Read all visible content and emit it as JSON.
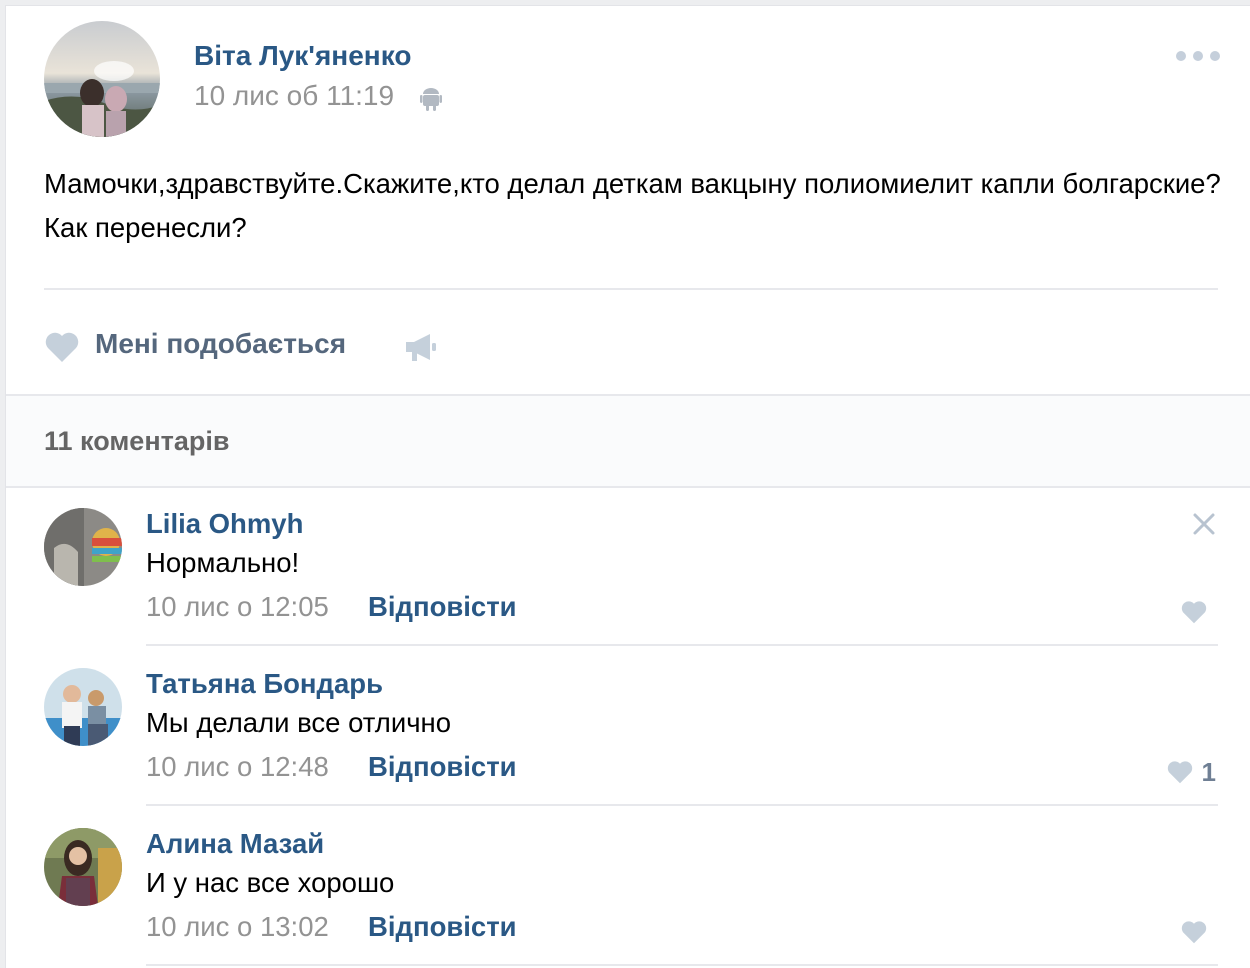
{
  "post": {
    "author": "Віта Лук'яненко",
    "date": "10 лис об 11:19",
    "device_icon": "android-icon",
    "text": "Мамочки,здравствуйте.Скажите,кто делал деткам вакцыну полиомиелит капли болгарские? Как перенесли?",
    "more_icon": "more-dots-icon"
  },
  "actions": {
    "like_label": "Мені подобається",
    "like_icon": "heart-icon",
    "share_icon": "megaphone-icon"
  },
  "comments_header": {
    "count_label": "11 коментарів"
  },
  "comments": [
    {
      "author": "Lilia Ohmyh",
      "text": "Нормально!",
      "date": "10 лис о 12:05",
      "reply": "Відповісти",
      "likes": "",
      "show_close": true
    },
    {
      "author": "Татьяна Бондарь",
      "text": "Мы делали все отлично",
      "date": "10 лис о 12:48",
      "reply": "Відповісти",
      "likes": "1",
      "show_close": false
    },
    {
      "author": "Алина Мазай",
      "text": "И у нас все хорошо",
      "date": "10 лис о 13:02",
      "reply": "Відповісти",
      "likes": "",
      "show_close": false
    }
  ],
  "colors": {
    "link": "#2a5885",
    "muted": "#939393",
    "icon": "#c5cfdb"
  }
}
